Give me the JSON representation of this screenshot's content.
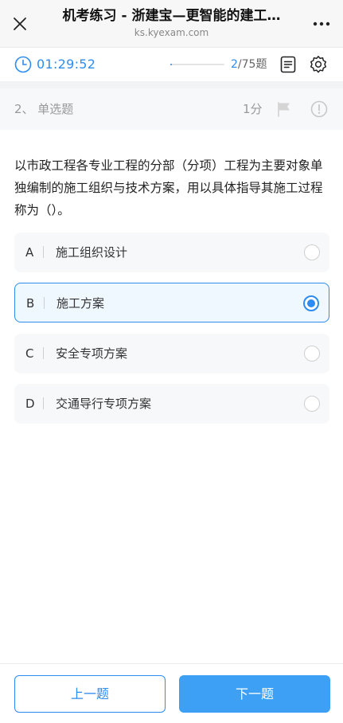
{
  "navbar": {
    "title": "机考练习 - 浙建宝—更智能的建工…",
    "subtitle": "ks.kyexam.com",
    "close_icon": "close-icon",
    "more_icon": "more-dots-icon"
  },
  "status": {
    "timer": "01:29:52",
    "progress_current": "2",
    "progress_total": "/75题",
    "progress_fraction": 0.027,
    "icons": [
      "clock-icon",
      "answer-sheet-icon",
      "gear-icon"
    ]
  },
  "question": {
    "type_label": "2、 单选题",
    "score": "1分",
    "stem": "以市政工程各专业工程的分部（分项）工程为主要对象单独编制的施工组织与技术方案，用以具体指导其施工过程称为（）。",
    "options": [
      {
        "letter": "A",
        "text": "施工组织设计",
        "selected": false
      },
      {
        "letter": "B",
        "text": "施工方案",
        "selected": true
      },
      {
        "letter": "C",
        "text": "安全专项方案",
        "selected": false
      },
      {
        "letter": "D",
        "text": "交通导行专项方案",
        "selected": false
      }
    ]
  },
  "footer": {
    "prev_label": "上一题",
    "next_label": "下一题"
  },
  "colors": {
    "accent": "#2d8cf0",
    "next_button": "#3da0f5",
    "muted_text": "#999999"
  }
}
